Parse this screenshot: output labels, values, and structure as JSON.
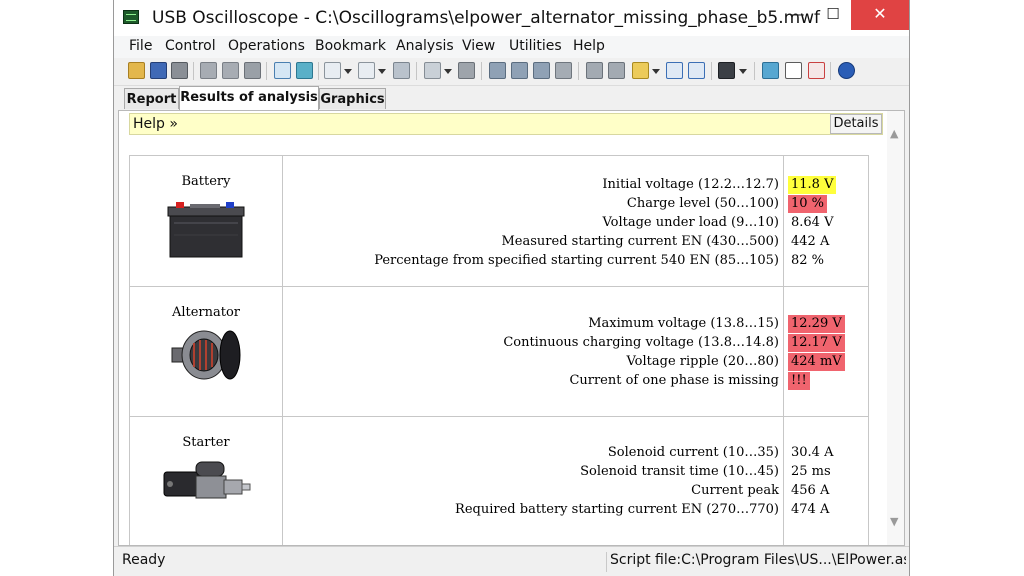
{
  "window": {
    "title": "USB Oscilloscope - C:\\Oscillograms\\elpower_alternator_missing_phase_b5.mwf",
    "min_glyph": "—",
    "max_glyph": "☐",
    "close_glyph": "✕"
  },
  "menu": {
    "items": [
      "File",
      "Control",
      "Operations",
      "Bookmark",
      "Analysis",
      "View",
      "Utilities",
      "Help"
    ]
  },
  "tabs": {
    "items": [
      "Report",
      "Results of analysis",
      "Graphics"
    ],
    "active": "Results of analysis"
  },
  "help": {
    "link": "Help »",
    "details_label": "Details"
  },
  "colors": {
    "highlight_yellow": "#ffff3c",
    "highlight_red": "#f0646e",
    "help_bar": "#ffffc8",
    "close_button": "#e04343"
  },
  "sections": [
    {
      "name": "Battery",
      "icon": "battery-image",
      "rows": [
        {
          "label": "Initial voltage (12.2…12.7)",
          "value": "11.8 V",
          "highlight": "yellow"
        },
        {
          "label": "Charge level (50…100)",
          "value": "10 %",
          "highlight": "red"
        },
        {
          "label": "Voltage under load (9…10)",
          "value": "8.64 V",
          "highlight": ""
        },
        {
          "label": "Measured starting current EN (430…500)",
          "value": "442 A",
          "highlight": ""
        },
        {
          "label": "Percentage from specified starting current 540 EN (85…105)",
          "value": "82 %",
          "highlight": ""
        }
      ]
    },
    {
      "name": "Alternator",
      "icon": "alternator-image",
      "rows": [
        {
          "label": "Maximum voltage (13.8…15)",
          "value": "12.29 V",
          "highlight": "red"
        },
        {
          "label": "Continuous charging voltage (13.8…14.8)",
          "value": "12.17 V",
          "highlight": "red"
        },
        {
          "label": "Voltage ripple (20…80)",
          "value": "424 mV",
          "highlight": "red"
        },
        {
          "label": "Current of one phase is missing",
          "value": "!!!",
          "highlight": "red"
        }
      ]
    },
    {
      "name": "Starter",
      "icon": "starter-image",
      "rows": [
        {
          "label": "Solenoid current (10…35)",
          "value": "30.4 A",
          "highlight": ""
        },
        {
          "label": "Solenoid transit time (10…45)",
          "value": "25 ms",
          "highlight": ""
        },
        {
          "label": "Current peak",
          "value": "456 A",
          "highlight": ""
        },
        {
          "label": "Required battery starting current EN (270…770)",
          "value": "474 A",
          "highlight": ""
        }
      ]
    }
  ],
  "status": {
    "left": "Ready",
    "right": "Script file:C:\\Program Files\\US...\\ElPower.asc"
  }
}
